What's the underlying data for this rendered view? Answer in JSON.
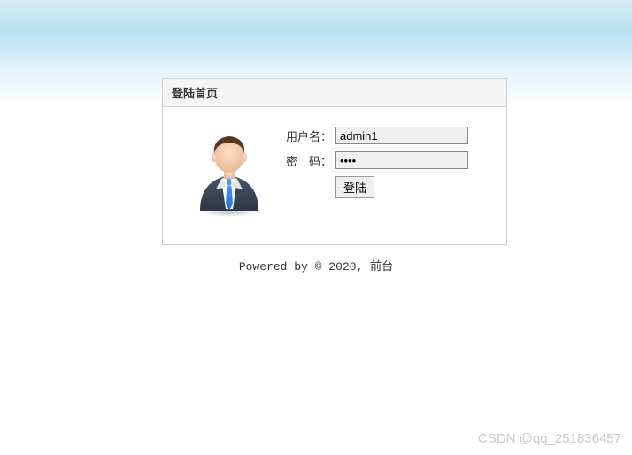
{
  "panel": {
    "title": "登陆首页"
  },
  "form": {
    "username_label": "用户名：",
    "username_value": "admin1",
    "password_label": "密　码：",
    "password_value": "••••",
    "submit_label": "登陆"
  },
  "footer": {
    "text": "Powered by © 2020, 前台"
  },
  "watermark": {
    "text": "CSDN @qq_251836457"
  },
  "icons": {
    "avatar": "user-avatar-icon"
  }
}
